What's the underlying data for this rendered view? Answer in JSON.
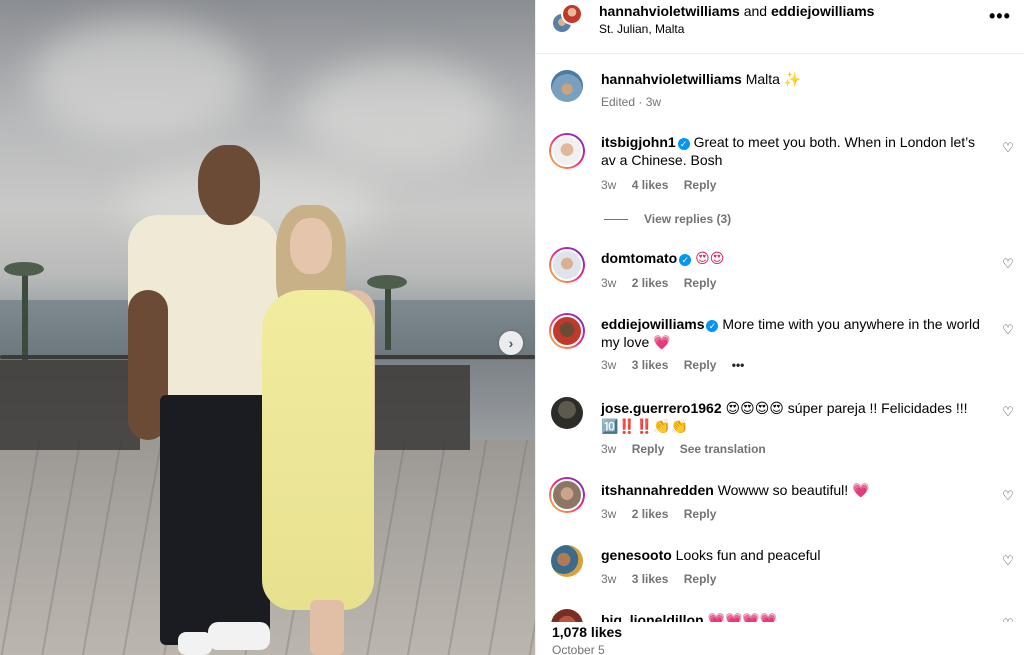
{
  "post": {
    "author": "hannahvioletwilliams",
    "joiner": "and",
    "coauthor": "eddiejowilliams",
    "location": "St. Julian, Malta",
    "more_icon": "more-horizontal-icon"
  },
  "caption": {
    "user": "hannahvioletwilliams",
    "text": "Malta ✨",
    "meta": "Edited · 3w"
  },
  "comments": [
    {
      "user": "itsbigjohn1",
      "verified": true,
      "text": "Great to meet you both. When in London let’s av a Chinese. Bosh",
      "time": "3w",
      "likes": "4 likes",
      "reply": "Reply",
      "view_replies": "View replies (3)"
    },
    {
      "user": "domtomato",
      "verified": true,
      "text": "😍😍",
      "time": "3w",
      "likes": "2 likes",
      "reply": "Reply"
    },
    {
      "user": "eddiejowilliams",
      "verified": true,
      "text": "More time with you anywhere in the world my love 💗",
      "time": "3w",
      "likes": "3 likes",
      "reply": "Reply",
      "more": "•••"
    },
    {
      "user": "jose.guerrero1962",
      "verified": false,
      "text": "😍😍😍😍 súper pareja !! Felicidades !!! 🔟‼️‼️👏👏",
      "time": "3w",
      "reply": "Reply",
      "translation": "See translation"
    },
    {
      "user": "itshannahredden",
      "verified": false,
      "text": "Wowww so beautiful! 💗",
      "time": "3w",
      "likes": "2 likes",
      "reply": "Reply"
    },
    {
      "user": "genesooto",
      "verified": false,
      "text": "Looks fun and peaceful",
      "time": "3w",
      "likes": "3 likes",
      "reply": "Reply"
    },
    {
      "user": "big_lioneldillon",
      "verified": false,
      "text": "💗💗💗💗"
    }
  ],
  "footer": {
    "likes": "1,078 likes",
    "date": "October 5"
  },
  "carousel": {
    "next_icon": "chevron-right-icon"
  },
  "colors": {
    "verified": "#0095f6",
    "muted": "#737373",
    "heart_emoji": "#e0245e"
  }
}
